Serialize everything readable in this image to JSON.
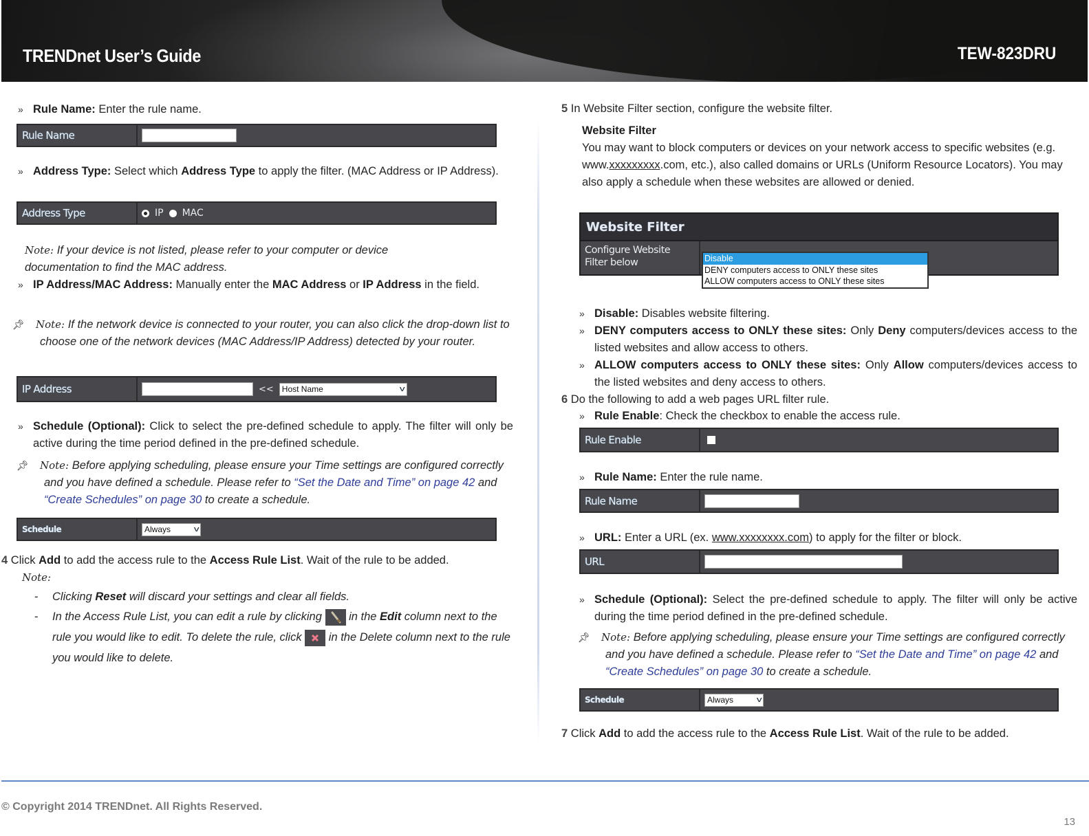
{
  "header": {
    "guide_title": "TRENDnet User’s Guide",
    "model": "TEW-823DRU"
  },
  "left": {
    "rule_name": {
      "label": "Rule Name:",
      "text": " Enter the rule name."
    },
    "rule_name_form": {
      "label": "Rule Name",
      "value": ""
    },
    "address_type": {
      "label": "Address Type:",
      "text1": " Select which ",
      "bold": "Address Type",
      "text2": " to apply the filter. (MAC Address or IP Address)."
    },
    "address_type_form": {
      "label": "Address Type",
      "options": [
        "IP",
        "MAC"
      ],
      "selected": "IP"
    },
    "note1": {
      "prefix": "Note:",
      "text": " If your device is not listed, please refer to your computer or device documentation to find the MAC address."
    },
    "ip_mac": {
      "label": "IP Address/MAC Address:",
      "text1": " Manually enter the ",
      "bold1": "MAC Address",
      "text2": " or ",
      "bold2": "IP Address",
      "text3": " in the field."
    },
    "note2": {
      "prefix": "Note:",
      "text": " If the network device is connected to your router, you can also click the drop-down list to choose one of the network devices (MAC Address/IP Address) detected by your router."
    },
    "ip_form": {
      "label": "IP Address",
      "value": "",
      "arrows": "<<",
      "host_select": "Host Name"
    },
    "schedule": {
      "label": "Schedule (Optional):",
      "text": " Click to select the pre-defined schedule to apply. The filter will only be active during the time period defined in the pre-defined schedule."
    },
    "note3": {
      "prefix": "Note:",
      "text1": " Before applying scheduling, please ensure your Time settings are configured correctly and you have defined a schedule. Please refer to ",
      "link1": "“Set the Date and Time” on page 42",
      "text2": " and ",
      "link2": "“Create Schedules” on page 30",
      "text3": " to create a schedule."
    },
    "schedule_form": {
      "label": "Schedule",
      "value": "Always"
    },
    "step4": {
      "num": "4",
      "t1": " Click ",
      "b1": "Add",
      "t2": " to add the access rule to the ",
      "b2": "Access Rule List",
      "t3": ". Wait of the rule to be added."
    },
    "note4": {
      "prefix": "Note:",
      "item1": {
        "t1": "Clicking ",
        "b1": "Reset",
        "t2": " will discard your settings and clear all fields."
      },
      "item2": {
        "t1": "In the Access Rule List, you can edit a rule by clicking ",
        "t2": " in the ",
        "b1": "Edit",
        "t3": " column next to the rule you would like to edit. To delete the rule, click ",
        "t4": " in the Delete column next to the rule you would like to delete."
      }
    }
  },
  "right": {
    "step5": {
      "num": "5",
      "text": " In Website Filter section, configure the website filter."
    },
    "wf_intro": {
      "title": "Website Filter",
      "t1": "You may want to block computers or devices on your network access to specific websites (e.g. www.",
      "u": "xxxxxxxxx",
      "t2": ".com, etc.), also called domains or URLs (Uniform Resource Locators). You may also apply a schedule when these websites are allowed or denied."
    },
    "wf_panel": {
      "title": "Website Filter",
      "row_label": "Configure Website Filter below",
      "options": [
        "Disable",
        "DENY computers access to ONLY these sites",
        "ALLOW computers access to ONLY these sites"
      ],
      "selected": "Disable"
    },
    "disable": {
      "label": "Disable:",
      "text": " Disables website filtering."
    },
    "deny": {
      "label": "DENY computers access to ONLY these sites:",
      "t1": " Only ",
      "b": "Deny",
      "t2": " computers/devices access to the listed websites and allow access to others."
    },
    "allow": {
      "label": "ALLOW computers access to ONLY these sites:",
      "t1": " Only ",
      "b": "Allow",
      "t2": " computers/devices access to the listed websites and deny access to others."
    },
    "step6": {
      "num": "6",
      "text": " Do the following to add a web pages URL filter rule."
    },
    "rule_enable": {
      "label": "Rule Enable",
      "text": ": Check the checkbox to enable the access rule."
    },
    "rule_enable_form": {
      "label": "Rule Enable",
      "checked": false
    },
    "rule_name": {
      "label": "Rule Name:",
      "text": " Enter the rule name."
    },
    "rule_name_form": {
      "label": "Rule Name",
      "value": ""
    },
    "url": {
      "label": "URL:",
      "t1": " Enter a URL (ex. ",
      "u": "www.xxxxxxxx.com",
      "t2": ") to apply for the filter or block."
    },
    "url_form": {
      "label": "URL",
      "value": ""
    },
    "schedule": {
      "label": "Schedule (Optional):",
      "text": " Select the  pre-defined schedule to apply. The filter will only be active during the time period defined in the pre-defined schedule."
    },
    "note": {
      "prefix": "Note:",
      "text1": " Before applying scheduling, please ensure your Time settings are configured correctly and you have defined a schedule. Please refer to ",
      "link1": "“Set the Date and Time” on page 42",
      "text2": " and ",
      "link2": "“Create Schedules” on page 30",
      "text3": " to create a schedule."
    },
    "schedule_form": {
      "label": "Schedule",
      "value": "Always"
    },
    "step7": {
      "num": "7",
      "t1": " Click ",
      "b1": "Add",
      "t2": " to add the access rule to the ",
      "b2": "Access Rule List",
      "t3": ". Wait of the rule to be added."
    }
  },
  "footer": {
    "copyright": "© Copyright 2014 TRENDnet. All Rights Reserved.",
    "page_number": "13"
  },
  "colors": {
    "form_bg": "#48484c",
    "link": "#2e3d98",
    "dropdown_highlight": "#2c9de0",
    "footer_rule": "#5b8bc9"
  }
}
